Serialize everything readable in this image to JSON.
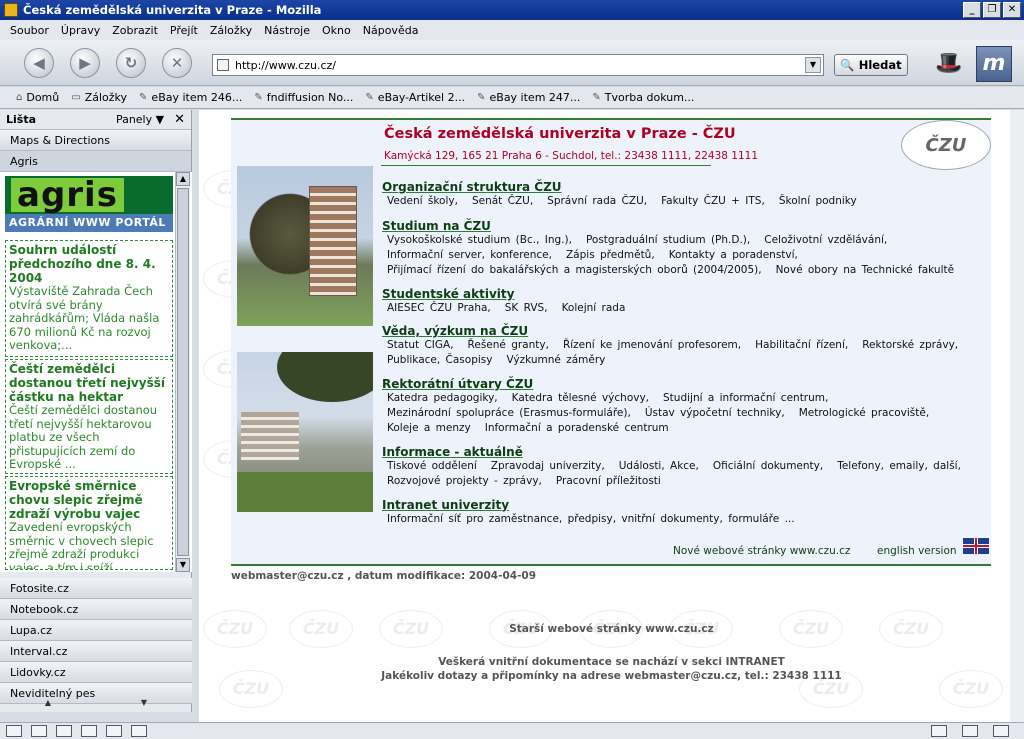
{
  "window": {
    "title": "Česká zemědělská univerzita v Praze - Mozilla"
  },
  "menubar": [
    "Soubor",
    "Úpravy",
    "Zobrazit",
    "Přejít",
    "Záložky",
    "Nástroje",
    "Okno",
    "Nápověda"
  ],
  "navbar": {
    "url": "http://www.czu.cz/",
    "search_label": "Hledat"
  },
  "bookmarks": [
    "Domů",
    "Záložky",
    "eBay item 246...",
    "fndiffusion No...",
    "eBay-Artikel 2...",
    "eBay item 247...",
    "Tvorba dokum..."
  ],
  "sidebar": {
    "title": "Lišta",
    "panels_label": "Panely",
    "top_tabs": [
      "Maps & Directions",
      "Agris"
    ],
    "agris_logo": "agris",
    "agris_subtitle": "AGRÁRNÍ WWW PORTÁL",
    "news": [
      {
        "title": "Souhrn událostí předchozího dne 8. 4. 2004",
        "text": "Výstaviště Zahrada Čech otvírá své brány zahrádkářům; Vláda našla 670 milionů Kč na rozvoj venkova;..."
      },
      {
        "title": "Čeští zemědělci dostanou třetí nejvyšší částku na hektar",
        "text": "Čeští zemědělci dostanou třetí nejvyšší hektarovou platbu ze všech přistupujících zemí do Evropské ..."
      },
      {
        "title": "Evropské směrnice chovu slepic zřejmě zdraží výrobu vajec",
        "text": "Zavedení evropských směrnic v chovech slepic zřejmě zdraží produkci vajec, a tím i sníží"
      }
    ],
    "bottom_tabs": [
      "Fotosite.cz",
      "Notebook.cz",
      "Lupa.cz",
      "Interval.cz",
      "Lidovky.cz",
      "Neviditelný pes"
    ]
  },
  "page": {
    "title": "Česká zemědělská univerzita v Praze - ČZU",
    "address": "Kamýcká 129, 165 21 Praha 6 - Suchdol, tel.: 23438 1111, 22438 1111",
    "seal_text": "ČZU",
    "sections": [
      {
        "heading": "Organizační struktura ČZU",
        "lines": [
          [
            "Vedení školy,",
            "Senát ČZU,",
            "Správní rada ČZU,",
            "Fakulty ČZU + ITS,",
            "Školní podniky"
          ]
        ]
      },
      {
        "heading": "Studium na ČZU",
        "lines": [
          [
            "Vysokoškolské studium (Bc., Ing.),",
            "Postgraduální studium (Ph.D.),",
            "Celoživotní vzdělávání,"
          ],
          [
            "Informační server, konference,",
            "Zápis předmětů,",
            "Kontakty a poradenství,"
          ],
          [
            "Přijímací řízení do bakalářských a magisterských oborů (2004/2005),",
            "Nové obory na Technické fakultě"
          ]
        ]
      },
      {
        "heading": "Studentské aktivity",
        "lines": [
          [
            "AIESEC ČZU Praha,",
            "SK RVS,",
            "Kolejní rada"
          ]
        ]
      },
      {
        "heading": "Věda,  výzkum na ČZU",
        "lines": [
          [
            "Statut CIGA,",
            "Řešené granty,",
            "Řízení ke jmenování profesorem,",
            "Habilitační řízení,",
            "Rektorské zprávy,"
          ],
          [
            "Publikace, Časopisy",
            "Výzkumné záměry"
          ]
        ]
      },
      {
        "heading": "Rektorátní útvary ČZU",
        "lines": [
          [
            "Katedra pedagogiky,",
            "Katedra tělesné výchovy,",
            "Studijní a informační centrum,"
          ],
          [
            "Mezinárodní spolupráce (Erasmus-formuláře),",
            "Ústav výpočetní techniky,",
            "Metrologické pracoviště,"
          ],
          [
            "Koleje a menzy",
            "Informační a poradenské centrum"
          ]
        ]
      },
      {
        "heading": "Informace - aktuálně",
        "lines": [
          [
            "Tiskové oddělení",
            "Zpravodaj univerzity,",
            "Události, Akce,",
            "Oficiální dokumenty,",
            "Telefony, emaily, další,"
          ],
          [
            "Rozvojové projekty - zprávy,",
            "Pracovní příležitosti"
          ]
        ]
      },
      {
        "heading": "Intranet univerzity",
        "lines": [
          [
            "Informační síť pro zaměstnance, předpisy, vnitřní dokumenty, formuláře ..."
          ]
        ]
      }
    ],
    "new_web": "Nové webové stránky www.czu.cz",
    "english": "english version",
    "webmaster_line": "webmaster@czu.cz ,   datum modifikace:  2004-04-09",
    "older_web": "Starší webové stránky www.czu.cz",
    "intranet_note": "Veškerá vnitřní dokumentace se nachází v sekci INTRANET",
    "contact_note": "Jakékoliv dotazy a připomínky na adrese webmaster@czu.cz, tel.: 23438 1111"
  }
}
